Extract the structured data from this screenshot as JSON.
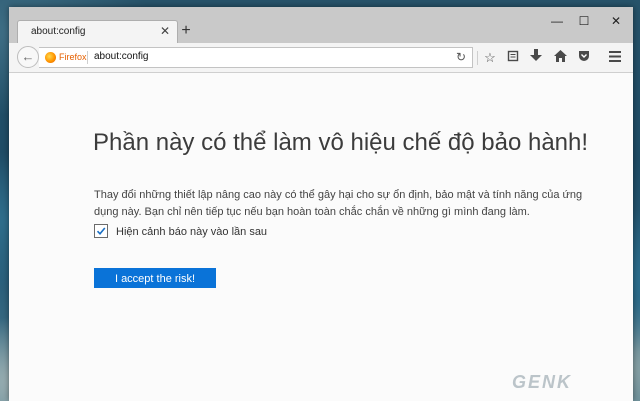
{
  "window": {
    "tab_title": "about:config",
    "controls": {
      "minimize": "—",
      "maximize": "☐",
      "close": "✕"
    }
  },
  "navbar": {
    "identity_label": "Firefox",
    "url": "about:config",
    "icons": [
      "back-icon",
      "reload-icon",
      "bookmark-star-icon",
      "reading-list-icon",
      "download-icon",
      "home-icon",
      "pocket-icon",
      "menu-icon"
    ]
  },
  "page": {
    "title": "Phần này có thể làm vô hiệu chế độ bảo hành!",
    "description": "Thay đổi những thiết lập nâng cao này có thể gây hại cho sự ổn định, bảo mật và tính năng của ứng dụng này. Bạn chỉ nên tiếp tục nếu bạn hoàn toàn chắc chắn về những gì mình đang làm.",
    "checkbox_label": "Hiện cảnh báo này vào lần sau",
    "checkbox_checked": true,
    "accept_button": "I accept the risk!"
  },
  "watermark": "GENK",
  "colors": {
    "accent": "#0a73d8",
    "firefox": "#e66000"
  }
}
